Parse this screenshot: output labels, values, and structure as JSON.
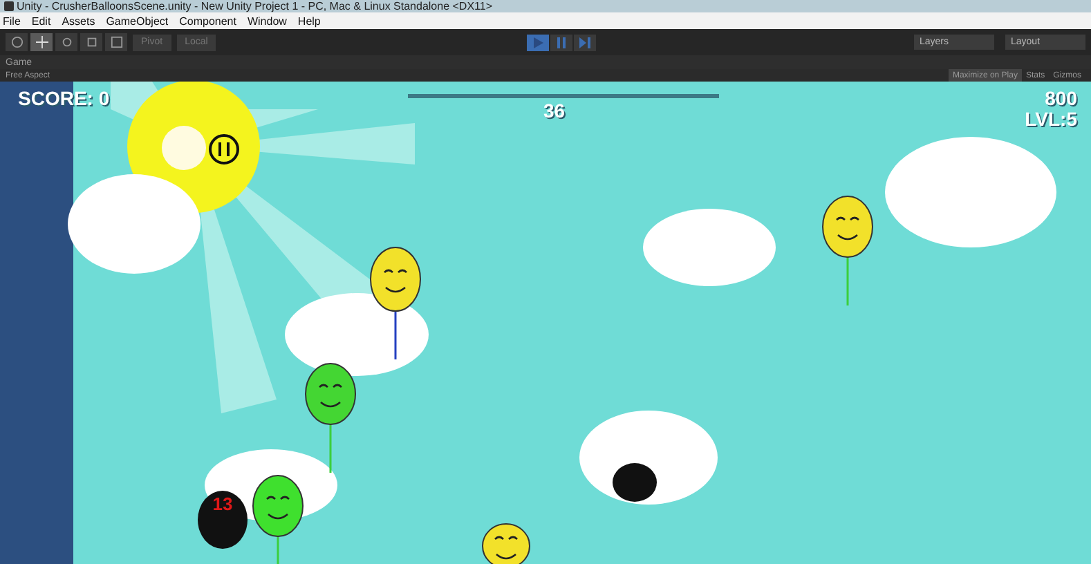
{
  "window": {
    "title": "Unity - CrusherBalloonsScene.unity - New Unity Project 1 - PC, Mac & Linux Standalone <DX11>"
  },
  "menu": [
    "File",
    "Edit",
    "Assets",
    "GameObject",
    "Component",
    "Window",
    "Help"
  ],
  "toolbar": {
    "tools": [
      {
        "kind": "hand",
        "selected": false
      },
      {
        "kind": "move",
        "selected": true
      },
      {
        "kind": "rotate",
        "selected": false
      },
      {
        "kind": "scale",
        "selected": false
      },
      {
        "kind": "rect",
        "selected": false
      }
    ],
    "pivot": "Pivot",
    "space": "Local",
    "playback": [
      {
        "kind": "play",
        "selected": true
      },
      {
        "kind": "pause",
        "selected": false
      },
      {
        "kind": "step",
        "selected": false
      }
    ],
    "layers": "Layers",
    "layout": "Layout"
  },
  "game_view": {
    "tab": "Game",
    "aspect": "Free Aspect",
    "options": [
      {
        "label": "Maximize on Play",
        "selected": true
      },
      {
        "label": "Stats",
        "selected": false
      },
      {
        "label": "Gizmos",
        "selected": false
      }
    ],
    "hud": {
      "score": "SCORE: 0",
      "timer": "36",
      "timer_bar": {
        "level": 1
      },
      "best": "800",
      "level": "LVL:5"
    },
    "objects": [
      {
        "kind": "balloon",
        "color": "#f2e12a"
      },
      {
        "kind": "balloon",
        "color": "#f2e12a"
      },
      {
        "kind": "balloon",
        "color": "#44d633"
      },
      {
        "kind": "balloon",
        "color": "#3fe02e"
      },
      {
        "kind": "bomb",
        "label": "13"
      },
      {
        "kind": "bomb"
      },
      {
        "kind": "balloon",
        "color": "#f2e12a"
      }
    ]
  }
}
